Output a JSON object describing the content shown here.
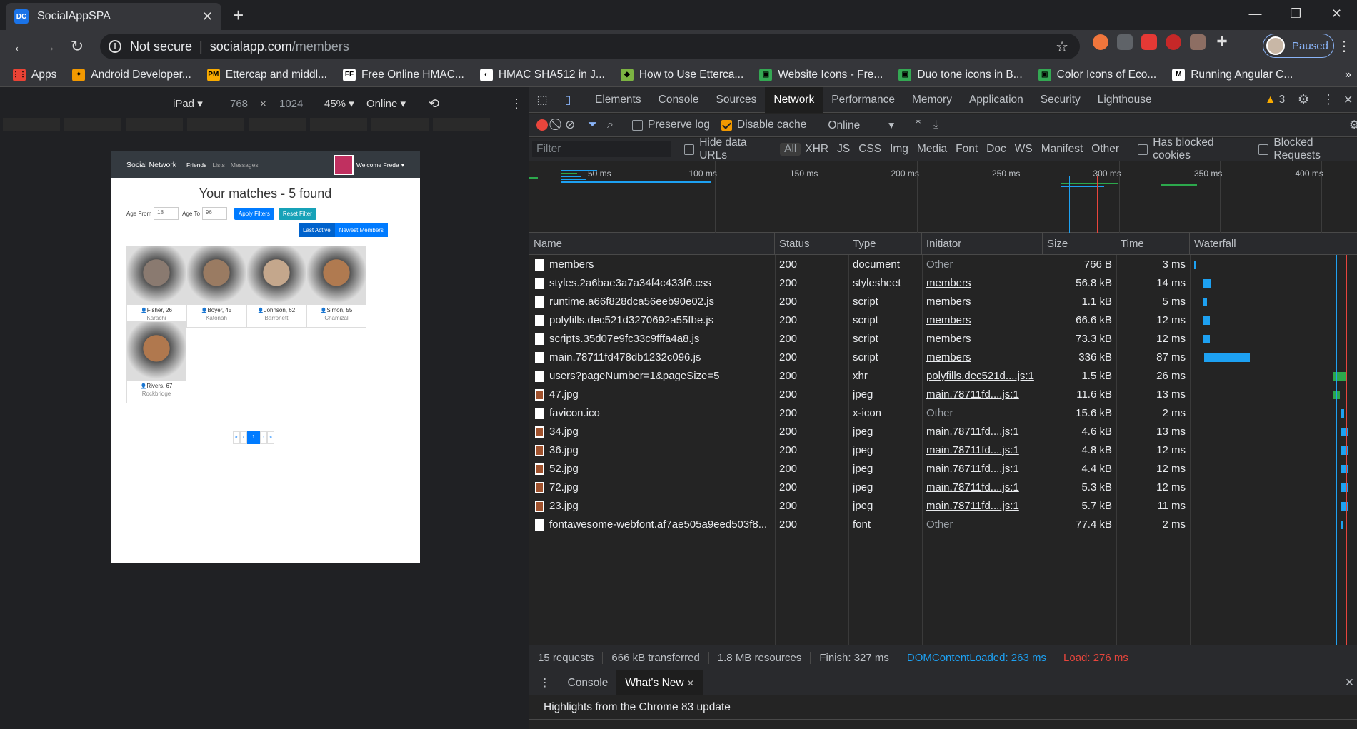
{
  "browser": {
    "tab_title": "SocialAppSPA",
    "tab_favicon": "DC",
    "new_tab": "+",
    "window_controls": [
      "—",
      "❐",
      "✕"
    ],
    "address": {
      "security": "Not secure",
      "host": "socialapp.com",
      "path": "/members"
    },
    "profile_label": "Paused"
  },
  "bookmarks": [
    {
      "label": "Apps",
      "color": "#ea4335",
      "glyph": "⋮⋮"
    },
    {
      "label": "Android Developer...",
      "color": "#f29900",
      "glyph": "✦"
    },
    {
      "label": "Ettercap and middl...",
      "color": "#f9ab00",
      "glyph": "PM"
    },
    {
      "label": "Free Online HMAC...",
      "color": "#ffffff",
      "glyph": "FF"
    },
    {
      "label": "HMAC SHA512 in J...",
      "color": "#ffffff",
      "glyph": "◐"
    },
    {
      "label": "How to Use Etterca...",
      "color": "#7cb342",
      "glyph": "◆"
    },
    {
      "label": "Website Icons - Fre...",
      "color": "#34a853",
      "glyph": "▣"
    },
    {
      "label": "Duo tone icons in B...",
      "color": "#34a853",
      "glyph": "▣"
    },
    {
      "label": "Color Icons of Eco...",
      "color": "#34a853",
      "glyph": "▣"
    },
    {
      "label": "Running Angular C...",
      "color": "#ffffff",
      "glyph": "M"
    }
  ],
  "device_toolbar": {
    "device": "iPad",
    "width": "768",
    "times": "×",
    "height": "1024",
    "zoom": "45%",
    "throttle": "Online"
  },
  "site": {
    "brand": "Social Network",
    "nav": [
      "Friends",
      "Lists",
      "Messages"
    ],
    "welcome": "Welcome Freda",
    "heading": "Your matches - 5 found",
    "age_from_label": "Age From",
    "age_from_value": "18",
    "age_to_label": "Age To",
    "age_to_value": "96",
    "apply_btn": "Apply Filters",
    "reset_btn": "Reset Filter",
    "last_active_btn": "Last Active",
    "newest_btn": "Newest Members",
    "members": [
      {
        "name": "Fisher, 26",
        "city": "Karachi",
        "skin": "#8a7a70"
      },
      {
        "name": "Boyer, 45",
        "city": "Katonah",
        "skin": "#9a7b62"
      },
      {
        "name": "Johnson, 62",
        "city": "Barronett",
        "skin": "#c4a78c"
      },
      {
        "name": "Simon, 55",
        "city": "Chamizal",
        "skin": "#b07a50"
      },
      {
        "name": "Rivers, 67",
        "city": "Rockbridge",
        "skin": "#b0784e"
      }
    ],
    "pager": [
      "«",
      "‹",
      "1",
      "›",
      "»"
    ]
  },
  "devtools": {
    "tabs": [
      "Elements",
      "Console",
      "Sources",
      "Network",
      "Performance",
      "Memory",
      "Application",
      "Security",
      "Lighthouse"
    ],
    "active_tab": "Network",
    "warnings": "3",
    "preserve_log": "Preserve log",
    "disable_cache": "Disable cache",
    "throttle": "Online",
    "filter_placeholder": "Filter",
    "hide_data_urls": "Hide data URLs",
    "types": [
      "All",
      "XHR",
      "JS",
      "CSS",
      "Img",
      "Media",
      "Font",
      "Doc",
      "WS",
      "Manifest",
      "Other"
    ],
    "has_blocked_cookies": "Has blocked cookies",
    "blocked_requests": "Blocked Requests",
    "overview_ticks": [
      "50 ms",
      "100 ms",
      "150 ms",
      "200 ms",
      "250 ms",
      "300 ms",
      "350 ms",
      "400 ms"
    ],
    "columns": [
      "Name",
      "Status",
      "Type",
      "Initiator",
      "Size",
      "Time",
      "Waterfall"
    ],
    "requests": [
      {
        "name": "members",
        "status": "200",
        "type": "document",
        "initiator": "Other",
        "size": "766 B",
        "time": "3 ms",
        "link": false
      },
      {
        "name": "styles.2a6bae3a7a34f4c433f6.css",
        "status": "200",
        "type": "stylesheet",
        "initiator": "members",
        "size": "56.8 kB",
        "time": "14 ms",
        "link": true
      },
      {
        "name": "runtime.a66f828dca56eeb90e02.js",
        "status": "200",
        "type": "script",
        "initiator": "members",
        "size": "1.1 kB",
        "time": "5 ms",
        "link": true
      },
      {
        "name": "polyfills.dec521d3270692a55fbe.js",
        "status": "200",
        "type": "script",
        "initiator": "members",
        "size": "66.6 kB",
        "time": "12 ms",
        "link": true
      },
      {
        "name": "scripts.35d07e9fc33c9fffa4a8.js",
        "status": "200",
        "type": "script",
        "initiator": "members",
        "size": "73.3 kB",
        "time": "12 ms",
        "link": true
      },
      {
        "name": "main.78711fd478db1232c096.js",
        "status": "200",
        "type": "script",
        "initiator": "members",
        "size": "336 kB",
        "time": "87 ms",
        "link": true
      },
      {
        "name": "users?pageNumber=1&pageSize=5",
        "status": "200",
        "type": "xhr",
        "initiator": "polyfills.dec521d....js:1",
        "size": "1.5 kB",
        "time": "26 ms",
        "link": true
      },
      {
        "name": "47.jpg",
        "status": "200",
        "type": "jpeg",
        "initiator": "main.78711fd....js:1",
        "size": "11.6 kB",
        "time": "13 ms",
        "link": true
      },
      {
        "name": "favicon.ico",
        "status": "200",
        "type": "x-icon",
        "initiator": "Other",
        "size": "15.6 kB",
        "time": "2 ms",
        "link": false
      },
      {
        "name": "34.jpg",
        "status": "200",
        "type": "jpeg",
        "initiator": "main.78711fd....js:1",
        "size": "4.6 kB",
        "time": "13 ms",
        "link": true
      },
      {
        "name": "36.jpg",
        "status": "200",
        "type": "jpeg",
        "initiator": "main.78711fd....js:1",
        "size": "4.8 kB",
        "time": "12 ms",
        "link": true
      },
      {
        "name": "52.jpg",
        "status": "200",
        "type": "jpeg",
        "initiator": "main.78711fd....js:1",
        "size": "4.4 kB",
        "time": "12 ms",
        "link": true
      },
      {
        "name": "72.jpg",
        "status": "200",
        "type": "jpeg",
        "initiator": "main.78711fd....js:1",
        "size": "5.3 kB",
        "time": "12 ms",
        "link": true
      },
      {
        "name": "23.jpg",
        "status": "200",
        "type": "jpeg",
        "initiator": "main.78711fd....js:1",
        "size": "5.7 kB",
        "time": "11 ms",
        "link": true
      },
      {
        "name": "fontawesome-webfont.af7ae505a9eed503f8...",
        "status": "200",
        "type": "font",
        "initiator": "Other",
        "size": "77.4 kB",
        "time": "2 ms",
        "link": false
      }
    ],
    "summary": {
      "requests": "15 requests",
      "transferred": "666 kB transferred",
      "resources": "1.8 MB resources",
      "finish": "Finish: 327 ms",
      "dcl": "DOMContentLoaded: 263 ms",
      "load": "Load: 276 ms"
    },
    "drawer_tabs": [
      "Console",
      "What's New"
    ],
    "drawer_active": "What's New",
    "highlights": "Highlights from the Chrome 83 update"
  }
}
